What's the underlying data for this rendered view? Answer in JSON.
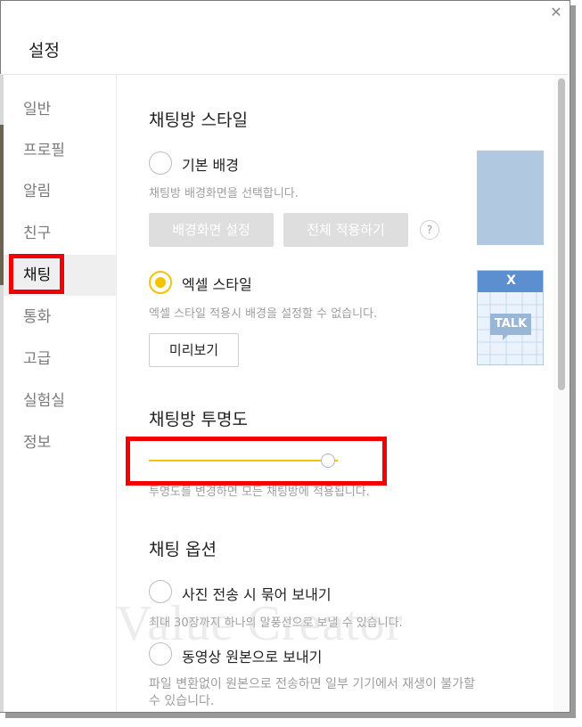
{
  "dialog": {
    "title": "설정",
    "close_glyph": "✕"
  },
  "sidebar": {
    "items": [
      {
        "label": "일반"
      },
      {
        "label": "프로필"
      },
      {
        "label": "알림"
      },
      {
        "label": "친구"
      },
      {
        "label": "채팅",
        "active": true
      },
      {
        "label": "통화"
      },
      {
        "label": "고급"
      },
      {
        "label": "실험실"
      },
      {
        "label": "정보"
      }
    ]
  },
  "chat_style": {
    "heading": "채팅방 스타일",
    "default_bg": {
      "label": "기본 배경",
      "desc": "채팅방 배경화면을 선택합니다.",
      "btn_set_bg": "배경화면 설정",
      "btn_apply_all": "전체 적용하기",
      "help": "?"
    },
    "excel": {
      "label": "엑셀 스타일",
      "desc": "엑셀 스타일 적용시 배경을 설정할 수 없습니다.",
      "btn_preview": "미리보기",
      "thumb_logo": "X",
      "thumb_talk": "TALK"
    }
  },
  "transparency": {
    "heading": "채팅방 투명도",
    "desc": "투명도를 변경하면 모든 채팅방에 적용됩니다.",
    "value": 0.95
  },
  "chat_options": {
    "heading": "채팅 옵션",
    "photo_group": {
      "label": "사진 전송 시 묶어 보내기",
      "desc": "최대 30장까지 하나의 말풍선으로 보낼 수 있습니다."
    },
    "video_original": {
      "label": "동영상 원본으로 보내기",
      "desc1": "파일 변환없이 원본으로 전송하면 일부 기기에서 재생이 불가할",
      "desc2": "수 있습니다."
    }
  },
  "watermark": "Value Creator",
  "colors": {
    "accent": "#f5c400",
    "highlight_red": "#f00000"
  }
}
